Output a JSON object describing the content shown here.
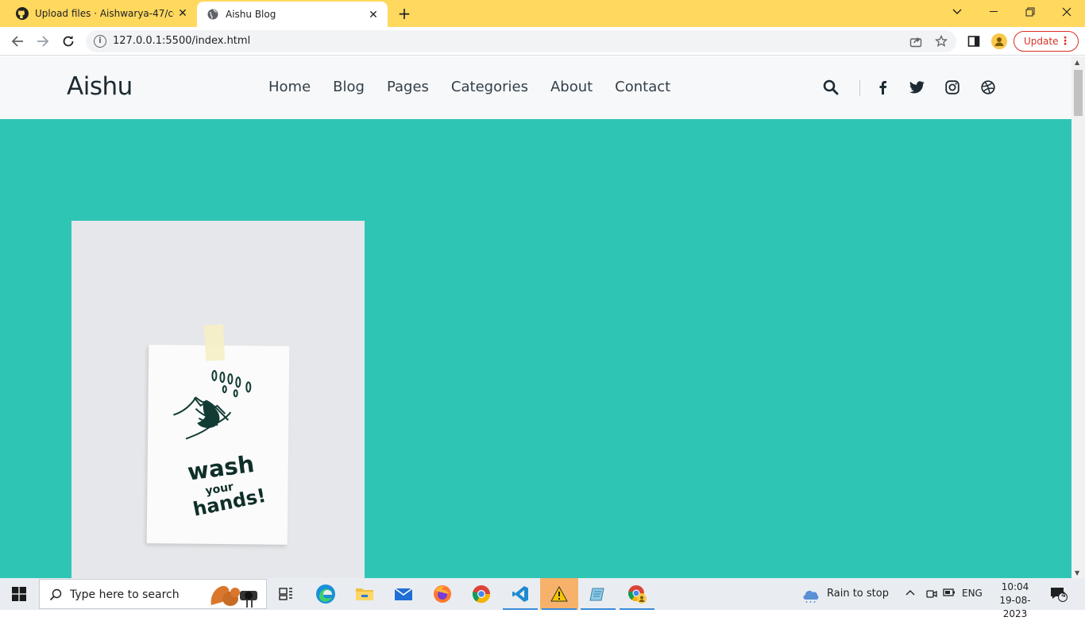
{
  "browser": {
    "tabs": [
      {
        "title": "Upload files · Aishwarya-47/code",
        "favicon": "github-icon",
        "active": false
      },
      {
        "title": "Aishu Blog",
        "favicon": "globe-icon",
        "active": true
      }
    ],
    "new_tab_label": "+",
    "url": "127.0.0.1:5500/index.html",
    "update_label": "Update",
    "accent": "#ffd85e"
  },
  "site": {
    "logo": "Aishu",
    "nav": [
      "Home",
      "Blog",
      "Pages",
      "Categories",
      "About",
      "Contact"
    ],
    "header_icons": [
      "search-icon",
      "facebook-icon",
      "twitter-icon",
      "instagram-icon",
      "dribbble-icon"
    ],
    "hero_background": "#2fc5b5",
    "hero_image_text": [
      "wash",
      "your",
      "hands!"
    ]
  },
  "taskbar": {
    "search_placeholder": "Type here to search",
    "apps": [
      "task-view-icon",
      "edge-icon",
      "file-explorer-icon",
      "mail-icon",
      "firefox-icon",
      "chrome-icon",
      "vscode-icon",
      "warning-app-icon",
      "notepad-icon",
      "chrome-profile-icon"
    ],
    "weather": "Rain to stop",
    "language": "ENG",
    "time": "10:04",
    "date": "19-08-2023",
    "notification_count": "4"
  }
}
